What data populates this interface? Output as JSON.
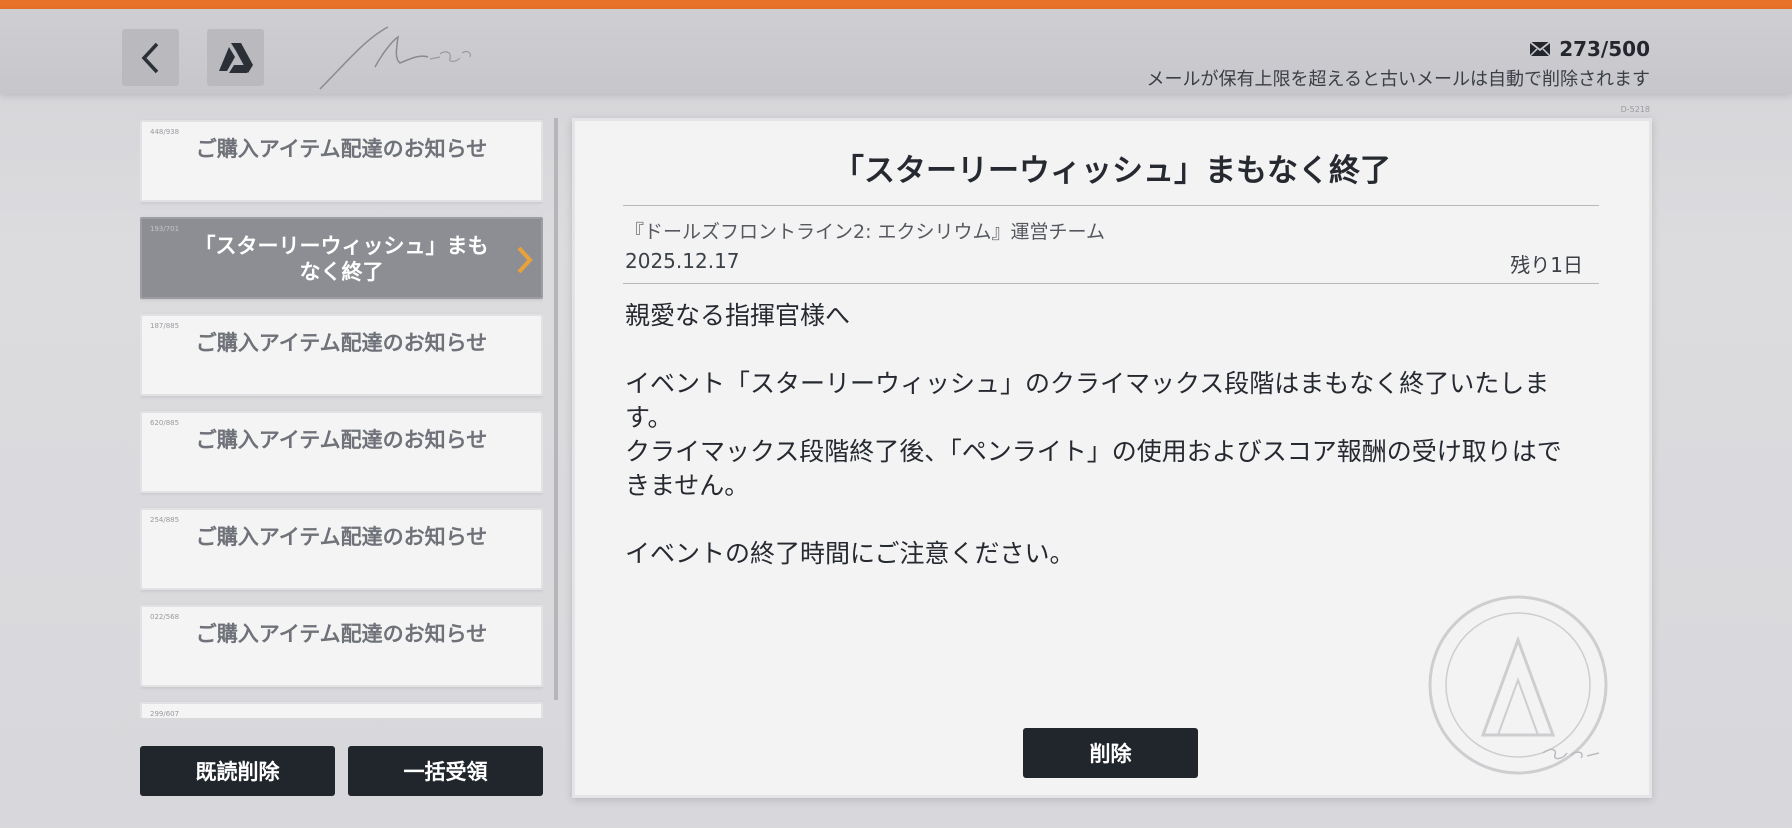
{
  "header": {
    "mail_count": "273/500",
    "mail_limit_note": "メールが保有上限を超えると古いメールは自動で削除されます"
  },
  "mail_list": [
    {
      "id": "448/938",
      "title": "ご購入アイテム配達のお知らせ",
      "selected": false
    },
    {
      "id": "193/701",
      "title": "「スターリーウィッシュ」まもなく終了",
      "selected": true
    },
    {
      "id": "187/885",
      "title": "ご購入アイテム配達のお知らせ",
      "selected": false
    },
    {
      "id": "620/885",
      "title": "ご購入アイテム配達のお知らせ",
      "selected": false
    },
    {
      "id": "254/885",
      "title": "ご購入アイテム配達のお知らせ",
      "selected": false
    },
    {
      "id": "022/568",
      "title": "ご購入アイテム配達のお知らせ",
      "selected": false
    },
    {
      "id": "299/607",
      "title": "",
      "selected": false
    }
  ],
  "buttons": {
    "delete_read": "既読削除",
    "receive_all": "一括受領",
    "delete": "削除"
  },
  "detail": {
    "code": "D-5218",
    "subject": "「スターリーウィッシュ」まもなく終了",
    "sender": "『ドールズフロントライン2: エクシリウム』運営チーム",
    "date": "2025.12.17",
    "remaining": "残り1日",
    "body": "親愛なる指揮官様へ\n\nイベント「スターリーウィッシュ」のクライマックス段階はまもなく終了いたします。\nクライマックス段階終了後、「ペンライト」の使用およびスコア報酬の受け取りはできません。\n\nイベントの終了時間にご注意ください。"
  },
  "colors": {
    "accent_orange": "#e8722a",
    "dark_button": "#21262d",
    "selected_item": "#8d8e93",
    "chevron": "#e9a23b"
  }
}
